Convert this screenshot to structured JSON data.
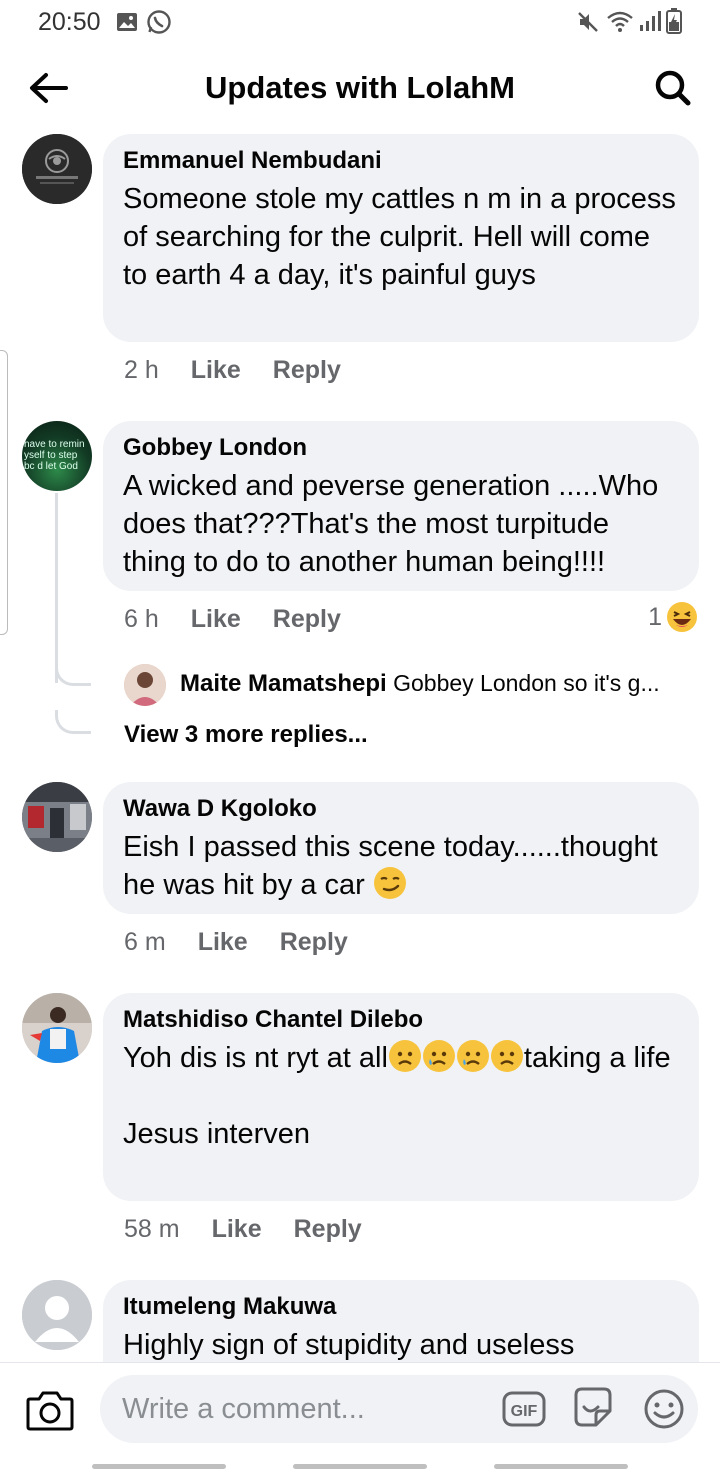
{
  "status_bar": {
    "time": "20:50"
  },
  "header": {
    "title": "Updates with LolahM"
  },
  "comments": [
    {
      "author": "Emmanuel Nembudani",
      "text": "Someone stole my cattles n m in a process of searching for the culprit. Hell will come to earth 4 a day, it's painful guys",
      "time": "2 h",
      "like": "Like",
      "reply": "Reply"
    },
    {
      "author": "Gobbey London",
      "text": "A wicked and peverse generation .....Who does that???That's the most turpitude thing to do to another human being!!!!",
      "time": "6 h",
      "like": "Like",
      "reply": "Reply",
      "reaction_count": "1",
      "avatar_text": "have to remin yself to step bc d let God be G"
    },
    {
      "author": "Wawa D Kgoloko",
      "text": "Eish I passed this scene today......thought he was hit by a car",
      "time": "6 m",
      "like": "Like",
      "reply": "Reply"
    },
    {
      "author": "Matshidiso Chantel Dilebo",
      "text_line1": "Yoh dis is nt ryt at all",
      "text_line2": "taking a life",
      "text_line3": "Jesus interven",
      "time": "58 m",
      "like": "Like",
      "reply": "Reply"
    },
    {
      "author": "Itumeleng Makuwa",
      "text": "Highly sign of stupidity and useless"
    }
  ],
  "reply_preview": {
    "author": "Maite Mamatshepi",
    "text": "Gobbey London so it's g..."
  },
  "view_more_replies": "View 3 more replies...",
  "composer": {
    "placeholder": "Write a comment..."
  },
  "icons": {
    "back": "arrow-left-icon",
    "search": "search-icon",
    "camera": "camera-icon",
    "gif": "gif-icon",
    "sticker": "sticker-icon",
    "emoji": "emoji-icon"
  }
}
